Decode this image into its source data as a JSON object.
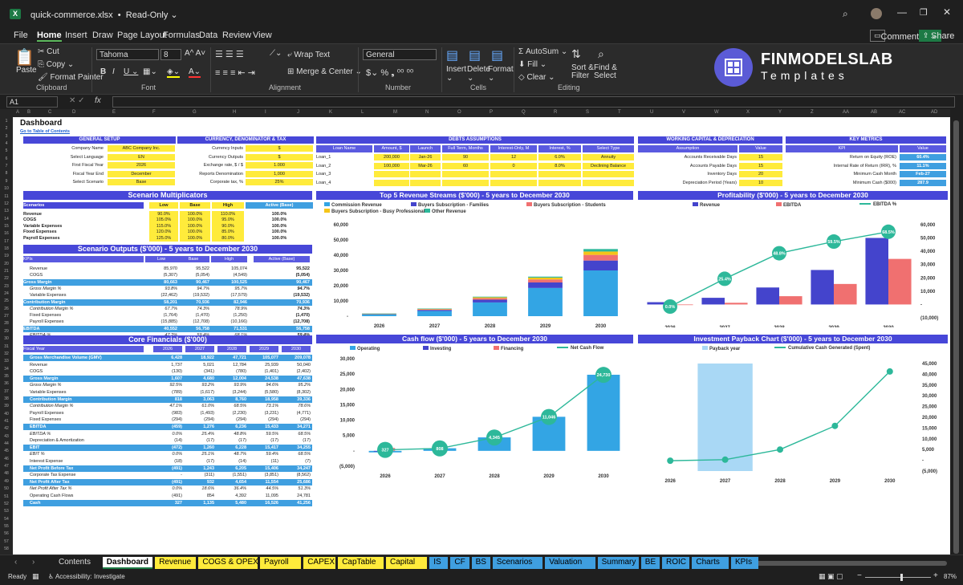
{
  "window": {
    "file_name": "quick-commerce.xlsx",
    "mode": "Read-Only"
  },
  "menu": {
    "file": "File",
    "home": "Home",
    "insert": "Insert",
    "draw": "Draw",
    "page_layout": "Page Layout",
    "formulas": "Formulas",
    "data": "Data",
    "review": "Review",
    "view": "View",
    "comments": "Comments",
    "share": "Share"
  },
  "ribbon": {
    "cut": "Cut",
    "copy": "Copy",
    "paste": "Paste",
    "format_painter": "Format Painter",
    "clipboard": "Clipboard",
    "font_name": "Tahoma",
    "font_size": "8",
    "font": "Font",
    "wrap_text": "Wrap Text",
    "merge_center": "Merge & Center",
    "alignment": "Alignment",
    "number_format": "General",
    "number": "Number",
    "insert": "Insert",
    "delete": "Delete",
    "format": "Format",
    "cells": "Cells",
    "autosum": "AutoSum",
    "fill": "Fill",
    "clear": "Clear",
    "sort_filter": "Sort & Filter",
    "find_select": "Find & Select",
    "editing": "Editing"
  },
  "logo": {
    "brand": "FINMODELSLAB",
    "sub": "Templates"
  },
  "formula": {
    "cell_ref": "A1",
    "fx": "fx"
  },
  "columns": [
    "A",
    "B",
    "C",
    "D",
    "E",
    "F",
    "G",
    "H",
    "I",
    "J",
    "K",
    "L",
    "M",
    "N",
    "O",
    "P",
    "Q",
    "R",
    "S",
    "T",
    "U",
    "V",
    "W",
    "X",
    "Y",
    "Z",
    "AA",
    "AB",
    "AC",
    "AD"
  ],
  "dash": {
    "title": "Dashboard",
    "link": "Go to Table of Contents",
    "general": {
      "header": "GENERAL SETUP",
      "rows": [
        [
          "Company Name",
          "ABC Company Inc."
        ],
        [
          "Select Language",
          "EN"
        ],
        [
          "First Fiscal Year",
          "2026"
        ],
        [
          "Fiscal Year End",
          "December"
        ],
        [
          "Select Scenario",
          "Base"
        ]
      ]
    },
    "currency": {
      "header": "CURRENCY, DENOMINATOR & TAX",
      "rows": [
        [
          "Currency Inputs",
          "$"
        ],
        [
          "Currency Outputs",
          "$"
        ],
        [
          "Exchange rate, $ / $",
          "1.000"
        ],
        [
          "Reports Denomination",
          "1,000"
        ],
        [
          "Corporate tax, %",
          "25%"
        ]
      ]
    },
    "debts": {
      "header": "DEBTS ASSUMPTIONS",
      "cols": [
        "Loan Name",
        "Amount, $",
        "Launch",
        "Full Term, Months",
        "Interest-Only, M",
        "Interest, %",
        "Select Type"
      ],
      "rows": [
        [
          "Loan_1",
          "200,000",
          "Jan-26",
          "90",
          "12",
          "6.0%",
          "Annuity"
        ],
        [
          "Loan_2",
          "100,000",
          "Mar-26",
          "60",
          "0",
          "8.0%",
          "Declining Balance"
        ],
        [
          "Loan_3",
          "",
          "",
          "",
          "",
          "",
          ""
        ],
        [
          "Loan_4",
          "",
          "",
          "",
          "",
          "",
          ""
        ]
      ]
    },
    "wc": {
      "header": "WORKING CAPITAL & DEPRECIATION",
      "cols": [
        "Assumption",
        "Value"
      ],
      "rows": [
        [
          "Accounts Receivable Days",
          "15"
        ],
        [
          "Accounts Payable Days",
          "15"
        ],
        [
          "Inventory Days",
          "20"
        ],
        [
          "Depreciation Period (Years)",
          "10"
        ]
      ]
    },
    "km": {
      "header": "KEY METRICS",
      "cols": [
        "KPI",
        "Value"
      ],
      "rows": [
        [
          "Return on Equity (ROE)",
          "60.4%"
        ],
        [
          "Internal Rate of Return (IRR), %",
          "11.1%"
        ],
        [
          "Minimum Cash Month",
          "Feb-27"
        ],
        [
          "Minimum Cash ($000)",
          "287.9"
        ]
      ]
    },
    "scen": {
      "header": "Scenario Multiplicators",
      "cols": [
        "Scenarios",
        "Low",
        "Base",
        "High",
        "Active (Base)"
      ],
      "rows": [
        [
          "Revenue",
          "90.0%",
          "100.0%",
          "110.0%",
          "100.0%"
        ],
        [
          "COGS",
          "105.0%",
          "100.0%",
          "95.0%",
          "100.0%"
        ],
        [
          "Variable Expenses",
          "115.0%",
          "100.0%",
          "90.0%",
          "100.0%"
        ],
        [
          "Fixed Expenses",
          "120.0%",
          "100.0%",
          "85.0%",
          "100.0%"
        ],
        [
          "Payroll Expenses",
          "125.0%",
          "100.0%",
          "80.0%",
          "100.0%"
        ]
      ]
    },
    "outputs": {
      "header": "Scenario Outputs ($'000) - 5 years to December 2030",
      "cols": [
        "KPIs",
        "Low",
        "Base",
        "High",
        "Active (Base)"
      ],
      "rows": [
        [
          "Revenue",
          "85,970",
          "95,522",
          "105,074",
          "95,522",
          ""
        ],
        [
          "COGS",
          "(5,307)",
          "(5,054)",
          "(4,549)",
          "(5,054)",
          ""
        ],
        [
          "Gross Margin",
          "80,663",
          "90,467",
          "100,525",
          "90,467",
          "b"
        ],
        [
          "Gross Margin %",
          "93.8%",
          "94.7%",
          "95.7%",
          "94.7%",
          "i"
        ],
        [
          "Variable Expenses",
          "(22,462)",
          "(19,532)",
          "(17,579)",
          "(19,532)",
          ""
        ],
        [
          "Contribution Margin",
          "58,201",
          "70,936",
          "82,946",
          "70,936",
          "b"
        ],
        [
          "Contribution Margin %",
          "67.7%",
          "74.3%",
          "78.9%",
          "74.3%",
          "i"
        ],
        [
          "Fixed Expenses",
          "(1,764)",
          "(1,470)",
          "(1,250)",
          "(1,470)",
          ""
        ],
        [
          "Payroll Expenses",
          "(15,885)",
          "(12,708)",
          "(10,166)",
          "(12,708)",
          ""
        ],
        [
          "EBITDA",
          "40,552",
          "56,758",
          "71,531",
          "56,758",
          "b"
        ],
        [
          "EBITDA %",
          "47.2%",
          "59.4%",
          "68.1%",
          "59.4%",
          "i"
        ]
      ]
    },
    "core": {
      "header": "Core Financials ($'000)",
      "cols": [
        "Fiscal Year",
        "2026",
        "2027",
        "2028",
        "2029",
        "2030"
      ],
      "rows": [
        [
          "Gross Merchandise Volume (GMV)",
          "6,428",
          "18,922",
          "47,721",
          "105,077",
          "209,078",
          "b"
        ],
        [
          "Revenue",
          "1,737",
          "5,021",
          "12,784",
          "25,939",
          "50,040",
          ""
        ],
        [
          "COGS",
          "(130)",
          "(341)",
          "(780)",
          "(1,401)",
          "(2,402)",
          ""
        ],
        [
          "Gross Margin",
          "1,607",
          "4,680",
          "12,004",
          "24,538",
          "47,638",
          "b"
        ],
        [
          "Gross Margin %",
          "92.5%",
          "93.2%",
          "93.9%",
          "94.6%",
          "95.2%",
          "i"
        ],
        [
          "Variable Expenses",
          "(789)",
          "(1,617)",
          "(3,244)",
          "(5,580)",
          "(8,302)",
          ""
        ],
        [
          "Contribution Margin",
          "818",
          "3,063",
          "8,760",
          "18,958",
          "39,336",
          "b"
        ],
        [
          "Contribution Margin %",
          "47.1%",
          "61.0%",
          "68.5%",
          "73.1%",
          "78.6%",
          "i"
        ],
        [
          "Payroll Expenses",
          "(983)",
          "(1,493)",
          "(2,230)",
          "(3,231)",
          "(4,771)",
          ""
        ],
        [
          "Fixed Expenses",
          "(294)",
          "(294)",
          "(294)",
          "(294)",
          "(294)",
          ""
        ],
        [
          "EBITDA",
          "(459)",
          "1,276",
          "6,236",
          "15,433",
          "34,271",
          "b"
        ],
        [
          "EBITDA %",
          "0.0%",
          "25.4%",
          "48.8%",
          "59.5%",
          "68.5%",
          "i"
        ],
        [
          "Depreciation & Amortization",
          "(14)",
          "(17)",
          "(17)",
          "(17)",
          "(17)",
          ""
        ],
        [
          "EBIT",
          "(472)",
          "1,260",
          "6,228",
          "15,417",
          "34,255",
          "b"
        ],
        [
          "EBIT %",
          "0.0%",
          "25.1%",
          "48.7%",
          "59.4%",
          "68.5%",
          "i"
        ],
        [
          "Interest Expense",
          "(18)",
          "(17)",
          "(14)",
          "(11)",
          "(7)",
          ""
        ],
        [
          "Net Profit Before Tax",
          "(491)",
          "1,243",
          "6,205",
          "15,406",
          "34,247",
          "b"
        ],
        [
          "Corporate Tax Expense",
          "-",
          "(311)",
          "(1,551)",
          "(3,851)",
          "(8,562)",
          ""
        ],
        [
          "Net Profit After Tax",
          "(491)",
          "932",
          "4,654",
          "11,554",
          "25,686",
          "b"
        ],
        [
          "Net Profit After Tax %",
          "0.0%",
          "18.6%",
          "36.4%",
          "44.5%",
          "51.3%",
          "i"
        ],
        [
          "Operating Cash Flows",
          "(491)",
          "854",
          "4,392",
          "11,095",
          "24,781",
          ""
        ],
        [
          "Cash",
          "327",
          "1,135",
          "5,480",
          "16,526",
          "41,256",
          "b"
        ]
      ]
    }
  },
  "charts": {
    "revenue": {
      "title": "Top 5 Revenue Streams ($'000) - 5 years to December 2030",
      "type": "bar",
      "categories": [
        "2026",
        "2027",
        "2028",
        "2029",
        "2030"
      ],
      "ylim": [
        0,
        60000
      ],
      "yticks": [
        "-",
        "10,000",
        "20,000",
        "30,000",
        "40,000",
        "50,000",
        "60,000"
      ],
      "series": [
        {
          "name": "Commission Revenue",
          "color": "#33a5e4",
          "values": [
            1100,
            3400,
            9000,
            18500,
            30000
          ]
        },
        {
          "name": "Buyers Subscription - Families",
          "color": "#4444cc",
          "values": [
            300,
            700,
            1800,
            3600,
            6500
          ]
        },
        {
          "name": "Buyers Subscription - Students",
          "color": "#f07070",
          "values": [
            150,
            400,
            1000,
            2000,
            3700
          ]
        },
        {
          "name": "Buyers Subscription - Busy Professionals",
          "color": "#f5c518",
          "values": [
            100,
            300,
            600,
            1200,
            2200
          ]
        },
        {
          "name": "Other Revenue",
          "color": "#2db89a",
          "values": [
            87,
            221,
            384,
            639,
            1640
          ]
        }
      ]
    },
    "profit": {
      "title": "Profitability ($'000) - 5 years to December 2030",
      "type": "bar",
      "categories": [
        "2026",
        "2027",
        "2028",
        "2029",
        "2030"
      ],
      "ylim": [
        -10000,
        60000
      ],
      "yticks": [
        "(10,000)",
        "-",
        "10,000",
        "20,000",
        "30,000",
        "40,000",
        "50,000",
        "60,000"
      ],
      "series": [
        {
          "name": "Revenue",
          "color": "#4444cc",
          "values": [
            1737,
            5021,
            12784,
            25939,
            50040
          ]
        },
        {
          "name": "EBITDA",
          "color": "#f07070",
          "values": [
            -459,
            1276,
            6236,
            15433,
            34271
          ]
        }
      ],
      "line": {
        "name": "EBITDA %",
        "color": "#2db89a",
        "labels": [
          "0.0%",
          "25.4%",
          "48.8%",
          "59.5%",
          "68.5%"
        ],
        "values": [
          0,
          25.4,
          48.8,
          59.5,
          68.5
        ]
      }
    },
    "cash": {
      "title": "Cash flow ($'000) - 5 years to December 2030",
      "type": "bar",
      "categories": [
        "2026",
        "2027",
        "2028",
        "2029",
        "2030"
      ],
      "ylim": [
        -5000,
        30000
      ],
      "yticks": [
        "(5,000)",
        "-",
        "5,000",
        "10,000",
        "15,000",
        "20,000",
        "25,000",
        "30,000"
      ],
      "series": [
        {
          "name": "Operating",
          "color": "#33a5e4",
          "values": [
            -491,
            854,
            4392,
            11095,
            24781
          ]
        },
        {
          "name": "Investing",
          "color": "#4444cc",
          "values": [
            -150,
            0,
            0,
            0,
            0
          ]
        },
        {
          "name": "Financing",
          "color": "#f07070",
          "values": [
            968,
            0,
            0,
            0,
            0
          ]
        }
      ],
      "line": {
        "name": "Net Cash Flow",
        "color": "#2db89a",
        "labels": [
          "327",
          "808",
          "4,345",
          "11,046",
          "24,730"
        ],
        "values": [
          327,
          808,
          4345,
          11046,
          24730
        ]
      }
    },
    "payback": {
      "title": "Investment Payback Chart ($'000) - 5 years to December 2030",
      "type": "line",
      "categories": [
        "2026",
        "2027",
        "2028",
        "2029",
        "2030"
      ],
      "ylim": [
        -5000,
        45000
      ],
      "yticks": [
        "(5,000)",
        "-",
        "5,000",
        "10,000",
        "15,000",
        "20,000",
        "25,000",
        "30,000",
        "35,000",
        "40,000",
        "45,000"
      ],
      "payback_label": "Payback year",
      "payback_index": 1,
      "line": {
        "name": "Cumulative Cash Generated (Spent)",
        "color": "#2db89a",
        "values": [
          -200,
          300,
          5000,
          16000,
          41300
        ]
      }
    }
  },
  "sheet_tabs": [
    {
      "label": "Contents",
      "color": "#1f1f1f",
      "active": false
    },
    {
      "label": "Dashboard",
      "color": "#ffffff",
      "active": true
    },
    {
      "label": "Revenue",
      "color": "#ffeb3b"
    },
    {
      "label": "COGS & OPEX",
      "color": "#ffeb3b"
    },
    {
      "label": "Payroll",
      "color": "#ffeb3b"
    },
    {
      "label": "CAPEX",
      "color": "#ffeb3b"
    },
    {
      "label": "CapTable",
      "color": "#ffeb3b"
    },
    {
      "label": "Capital",
      "color": "#ffeb3b"
    },
    {
      "label": "IS",
      "color": "#3f9fe0"
    },
    {
      "label": "CF",
      "color": "#3f9fe0"
    },
    {
      "label": "BS",
      "color": "#3f9fe0"
    },
    {
      "label": "Scenarios",
      "color": "#3f9fe0"
    },
    {
      "label": "Valuation",
      "color": "#3f9fe0"
    },
    {
      "label": "Summary",
      "color": "#3f9fe0"
    },
    {
      "label": "BE",
      "color": "#3f9fe0"
    },
    {
      "label": "ROIC",
      "color": "#3f9fe0"
    },
    {
      "label": "Charts",
      "color": "#3f9fe0"
    },
    {
      "label": "KPIs",
      "color": "#3f9fe0"
    }
  ],
  "status": {
    "ready": "Ready",
    "accessibility": "Accessibility: Investigate",
    "zoom": "87%"
  }
}
